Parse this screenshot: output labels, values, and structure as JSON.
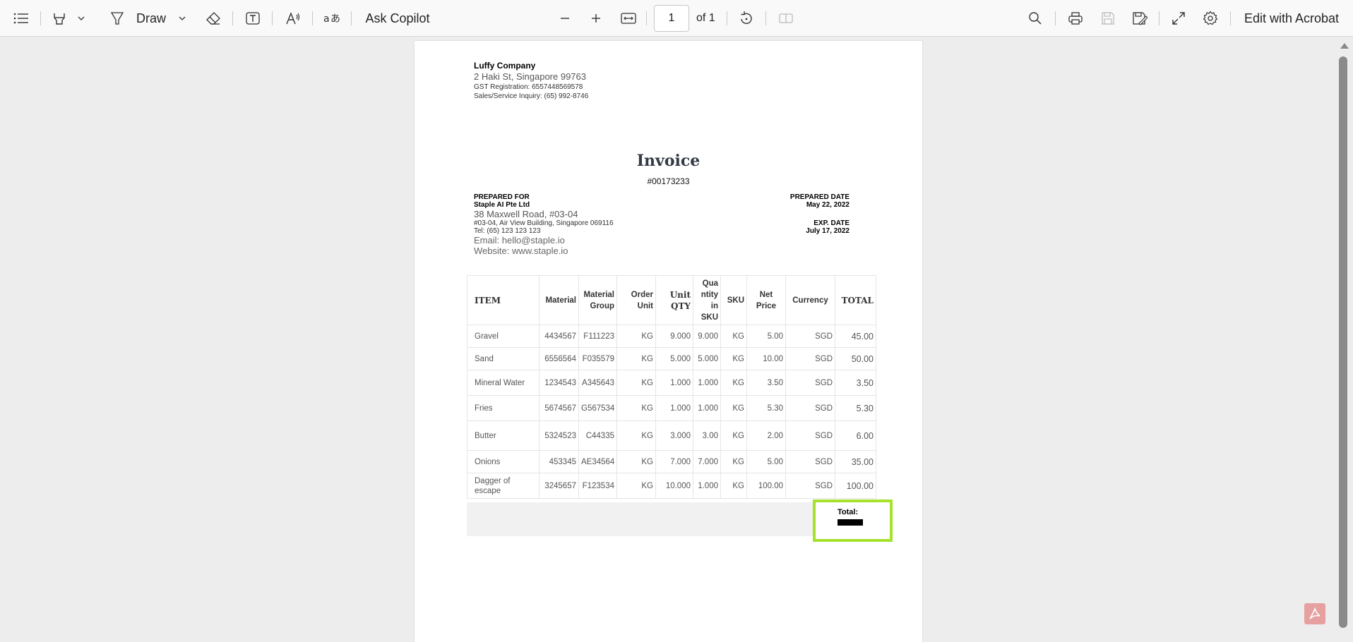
{
  "toolbar": {
    "draw_label": "Draw",
    "ask_copilot_label": "Ask Copilot",
    "page_number": "1",
    "page_count_label": "of 1",
    "edit_with_acrobat_label": "Edit with Acrobat"
  },
  "document": {
    "company": {
      "name": "Luffy Company",
      "address": "2 Haki St, Singapore 99763",
      "gst": "GST Registration: 6557448569578",
      "inquiry": "Sales/Service Inquiry: (65) 992-8746"
    },
    "title": "Invoice",
    "number": "#00173233",
    "prepared_for": {
      "label": "PREPARED FOR",
      "name": "Staple AI Pte Ltd",
      "address1": "38 Maxwell Road, #03-04",
      "address2": "#03-04, Air View Building, Singapore 069116",
      "tel": "Tel: (65) 123 123 123",
      "email": "Email: hello@staple.io",
      "website": "Website: www.staple.io"
    },
    "prepared_date": {
      "label": "PREPARED DATE",
      "value": "May 22, 2022"
    },
    "exp_date": {
      "label": "EXP. DATE",
      "value": "July 17, 2022"
    },
    "table": {
      "headers": {
        "item": "ITEM",
        "material": "Material",
        "material_group": "Material Group",
        "order_unit": "Order Unit",
        "unit_qty": "Unit QTY",
        "quantity_sku": "Qua ntity in SKU",
        "sku": "SKU",
        "net_price": "Net Price",
        "currency": "Currency",
        "total": "TOTAL"
      },
      "rows": [
        {
          "item": "Gravel",
          "material": "4434567",
          "group": "F111223",
          "unit": "KG",
          "qty": "9.000",
          "qsku": "9.000",
          "sku": "KG",
          "price": "5.00",
          "currency": "SGD",
          "total": "45.00"
        },
        {
          "item": "Sand",
          "material": "6556564",
          "group": "F035579",
          "unit": "KG",
          "qty": "5.000",
          "qsku": "5.000",
          "sku": "KG",
          "price": "10.00",
          "currency": "SGD",
          "total": "50.00"
        },
        {
          "item": "Mineral Water",
          "material": "1234543",
          "group": "A345643",
          "unit": "KG",
          "qty": "1.000",
          "qsku": "1.000",
          "sku": "KG",
          "price": "3.50",
          "currency": "SGD",
          "total": "3.50"
        },
        {
          "item": "Fries",
          "material": "5674567",
          "group": "G567534",
          "unit": "KG",
          "qty": "1.000",
          "qsku": "1.000",
          "sku": "KG",
          "price": "5.30",
          "currency": "SGD",
          "total": "5.30"
        },
        {
          "item": "Butter",
          "material": "5324523",
          "group": "C44335",
          "unit": "KG",
          "qty": "3.000",
          "qsku": "3.00",
          "sku": "KG",
          "price": "2.00",
          "currency": "SGD",
          "total": "6.00"
        },
        {
          "item": "Onions",
          "material": "453345",
          "group": "AE34564",
          "unit": "KG",
          "qty": "7.000",
          "qsku": "7.000",
          "sku": "KG",
          "price": "5.00",
          "currency": "SGD",
          "total": "35.00"
        },
        {
          "item": "Dagger of escape",
          "material": "3245657",
          "group": "F123534",
          "unit": "KG",
          "qty": "10.000",
          "qsku": "1.000",
          "sku": "KG",
          "price": "100.00",
          "currency": "SGD",
          "total": "100.00"
        }
      ]
    },
    "total_label": "Total:"
  },
  "colors": {
    "highlight": "#a4e22b",
    "toolbar_bg": "#f9f9f9",
    "canvas_bg": "#ededed"
  },
  "icons": [
    "contents-icon",
    "highlight-icon",
    "draw-icon",
    "eraser-icon",
    "text-box-icon",
    "read-aloud-icon",
    "translate-icon",
    "zoom-out-icon",
    "zoom-in-icon",
    "fit-width-icon",
    "rotate-icon",
    "two-page-icon",
    "search-icon",
    "print-icon",
    "save-icon",
    "save-as-icon",
    "fullscreen-icon",
    "settings-icon",
    "acrobat-icon"
  ]
}
